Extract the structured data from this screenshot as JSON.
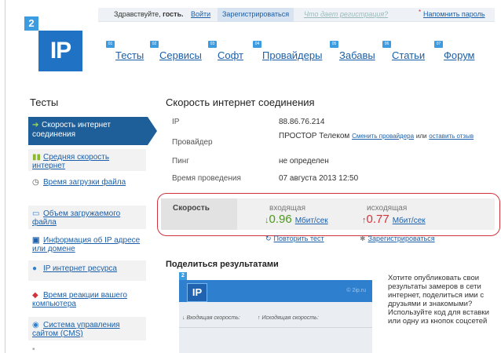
{
  "logo": {
    "badge": "2",
    "text": "IP"
  },
  "topbar": {
    "greeting_prefix": "Здравствуйте,",
    "greeting_user": "гость.",
    "login": "Войти",
    "register": "Зарегистрироваться",
    "why_register": "Что дает регистрация?",
    "remind_password": "Напомнить пароль"
  },
  "nav": [
    {
      "label": "Тесты",
      "icon": "tests-icon"
    },
    {
      "label": "Сервисы",
      "icon": "services-icon"
    },
    {
      "label": "Софт",
      "icon": "software-icon"
    },
    {
      "label": "Провайдеры",
      "icon": "providers-icon"
    },
    {
      "label": "Забавы",
      "icon": "fun-icon"
    },
    {
      "label": "Статьи",
      "icon": "articles-icon"
    },
    {
      "label": "Форум",
      "icon": "forum-icon"
    }
  ],
  "sidebar": {
    "title": "Тесты",
    "items": [
      {
        "label": "Скорость интернет соединения",
        "icon": "speed-arrow-icon"
      },
      {
        "label": "Средняя скорость интернет",
        "icon": "bars-icon"
      },
      {
        "label": "Время загрузки файла",
        "icon": "clock-icon"
      },
      {
        "label": "Объем загружаемого файла",
        "icon": "monitor-icon"
      },
      {
        "label": "Информация об IP адресе или домене",
        "icon": "ip-icon"
      },
      {
        "label": "IP интернет ресурса",
        "icon": "globe-icon"
      },
      {
        "label": "Время реакции вашего компьютера",
        "icon": "reaction-icon"
      },
      {
        "label": "Система управления сайтом (CMS)",
        "icon": "cms-icon"
      }
    ]
  },
  "main": {
    "title": "Скорость интернет соединения",
    "info": {
      "ip_label": "IP",
      "ip_value": "88.86.76.214",
      "provider_label": "Провайдер",
      "provider_value": "ПРОСТОР Телеком",
      "change_provider": "Сменить провайдера",
      "or": "или",
      "leave_review": "оставить отзыв",
      "ping_label": "Пинг",
      "ping_value": "не определен",
      "time_label": "Время проведения",
      "time_value": "07 августа 2013 12:50"
    },
    "speed": {
      "label": "Скорость",
      "incoming_label": "входящая",
      "incoming_value": "0.96",
      "outgoing_label": "исходящая",
      "outgoing_value": "0.77",
      "unit": "Мбит/сек",
      "down_arrow": "↓",
      "up_arrow": "↑"
    },
    "repeat_test": "Повторить тест",
    "register_link": "Зарегистрироваться",
    "share": {
      "title": "Поделиться результатами",
      "preview_badge": "2",
      "preview_logo": "IP",
      "preview_site": "© 2ip.ru",
      "preview_incoming": "↓ Входящая скорость:",
      "preview_outgoing": "↑ Исходящая скорость:",
      "text": "Хотите опубликовать свои результаты замеров в сети интернет, поделиться ими с друзьями и знакомыми? Используйте код для вставки или одну из кнопок соцсетей"
    }
  },
  "colors": {
    "brand": "#1f72c4",
    "accent": "#3d9be0",
    "link": "#1a5fa8",
    "download": "#4a9a1a",
    "upload": "#d0343c"
  }
}
